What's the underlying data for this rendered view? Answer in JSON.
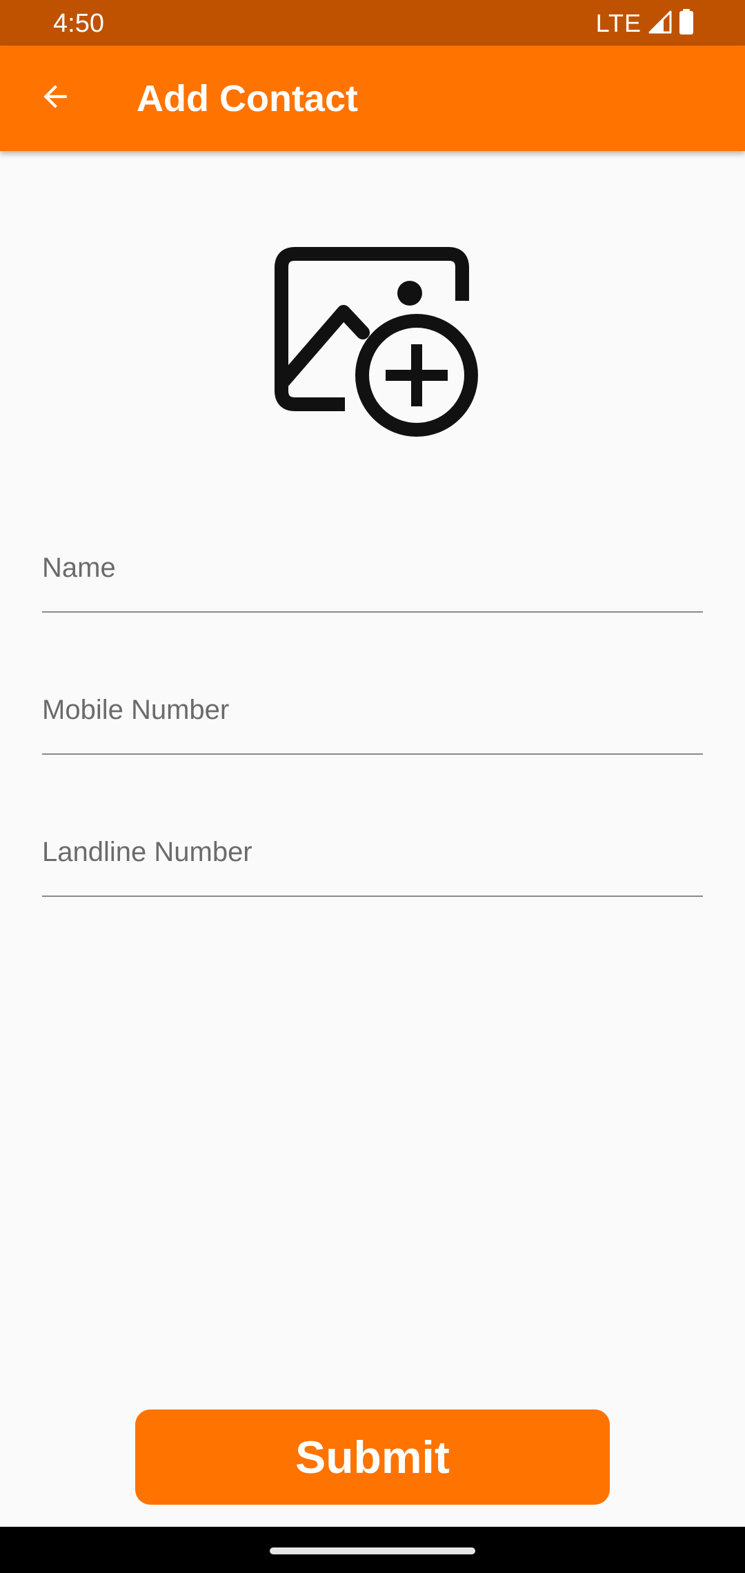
{
  "status_bar": {
    "time": "4:50",
    "network": "LTE"
  },
  "app_bar": {
    "title": "Add Contact",
    "back_icon": "arrow-back-icon",
    "color": "#ff7300"
  },
  "photo_picker": {
    "icon": "add-photo-icon"
  },
  "form": {
    "fields": [
      {
        "label": "Name",
        "value": ""
      },
      {
        "label": "Mobile Number",
        "value": ""
      },
      {
        "label": "Landline Number",
        "value": ""
      }
    ]
  },
  "submit": {
    "label": "Submit",
    "color": "#ff7300"
  },
  "colors": {
    "status_bar": "#bf5200",
    "background": "#fafafa"
  }
}
